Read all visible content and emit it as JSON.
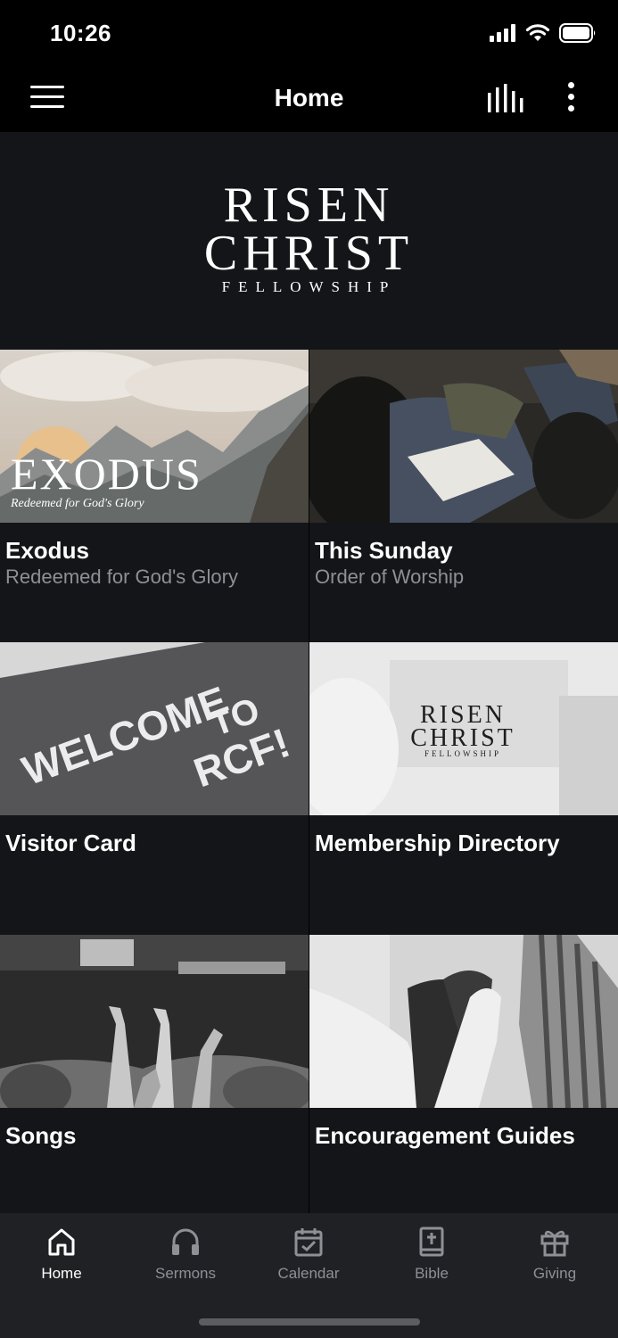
{
  "status_bar": {
    "time": "10:26"
  },
  "nav": {
    "title": "Home"
  },
  "logo": {
    "line1": "RISEN",
    "line2": "CHRIST",
    "line3": "FELLOWSHIP"
  },
  "tiles": [
    {
      "title": "Exodus",
      "subtitle": "Redeemed for God's Glory",
      "image_text": "EXODUS",
      "image_subtext": "Redeemed for God's Glory"
    },
    {
      "title": "This Sunday",
      "subtitle": "Order of Worship"
    },
    {
      "title": "Visitor Card",
      "subtitle": "",
      "image_text_1": "WELCOME",
      "image_text_2": "TO",
      "image_text_3": "RCF!"
    },
    {
      "title": "Membership Directory",
      "subtitle": "",
      "image_text_1": "RISEN",
      "image_text_2": "CHRIST",
      "image_text_3": "FELLOWSHIP"
    },
    {
      "title": "Songs",
      "subtitle": ""
    },
    {
      "title": "Encouragement Guides",
      "subtitle": ""
    }
  ],
  "tabs": [
    {
      "label": "Home",
      "icon": "home-icon",
      "active": true
    },
    {
      "label": "Sermons",
      "icon": "headphones-icon",
      "active": false
    },
    {
      "label": "Calendar",
      "icon": "calendar-check-icon",
      "active": false
    },
    {
      "label": "Bible",
      "icon": "bible-icon",
      "active": false
    },
    {
      "label": "Giving",
      "icon": "gift-icon",
      "active": false
    }
  ],
  "colors": {
    "background": "#000000",
    "tile_background": "#141518",
    "tab_bar": "#202124",
    "subtitle_gray": "#8e9096",
    "active_tab": "#ffffff"
  }
}
